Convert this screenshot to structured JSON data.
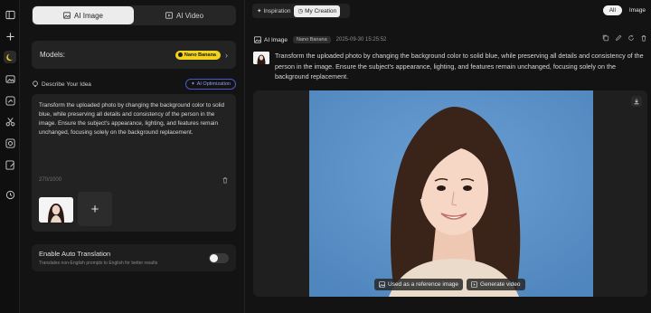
{
  "rail": {
    "icons": [
      "sidebar-toggle-icon",
      "plus-icon",
      "moon-icon",
      "image-gen-icon",
      "image-edit-icon",
      "scissors-icon",
      "face-swap-icon",
      "edit-photo-icon",
      "history-icon"
    ]
  },
  "left": {
    "tabs": [
      {
        "label": "AI Image",
        "active": true
      },
      {
        "label": "AI Video",
        "active": false
      }
    ],
    "models": {
      "label": "Models:",
      "selected": "Nano Banana"
    },
    "describe": {
      "label": "Describe Your Idea",
      "optimization": "AI Optimization"
    },
    "prompt": {
      "text": "Transform the uploaded photo by changing the background color to solid blue, while preserving all details and consistency of the person in the image. Ensure the subject's appearance, lighting, and features remain unchanged, focusing solely on the background replacement.",
      "count": "270/1000"
    },
    "auto_translation": {
      "title": "Enable Auto Translation",
      "subtitle": "Translates non-English prompts to English for better results",
      "enabled": false
    }
  },
  "right": {
    "subtabs": [
      {
        "label": "Inspiration",
        "active": false
      },
      {
        "label": "My Creation",
        "active": true
      }
    ],
    "filters": {
      "all": "All",
      "image": "Image"
    },
    "entry": {
      "type": "AI Image",
      "model": "Nano Banana",
      "timestamp": "2025-09-30 15:25:52",
      "prompt": "Transform the uploaded photo by changing the background color to solid blue, while preserving all details and consistency of the person in the image. Ensure the subject's appearance, lighting, and features remain unchanged, focusing solely on the background replacement."
    },
    "result_actions": {
      "reference": "Used as a reference image",
      "generate_video": "Generate video"
    },
    "colors": {
      "background_blue": "#5b8fc4",
      "accent": "#4a59c9",
      "badge": "#f2d21c"
    }
  }
}
